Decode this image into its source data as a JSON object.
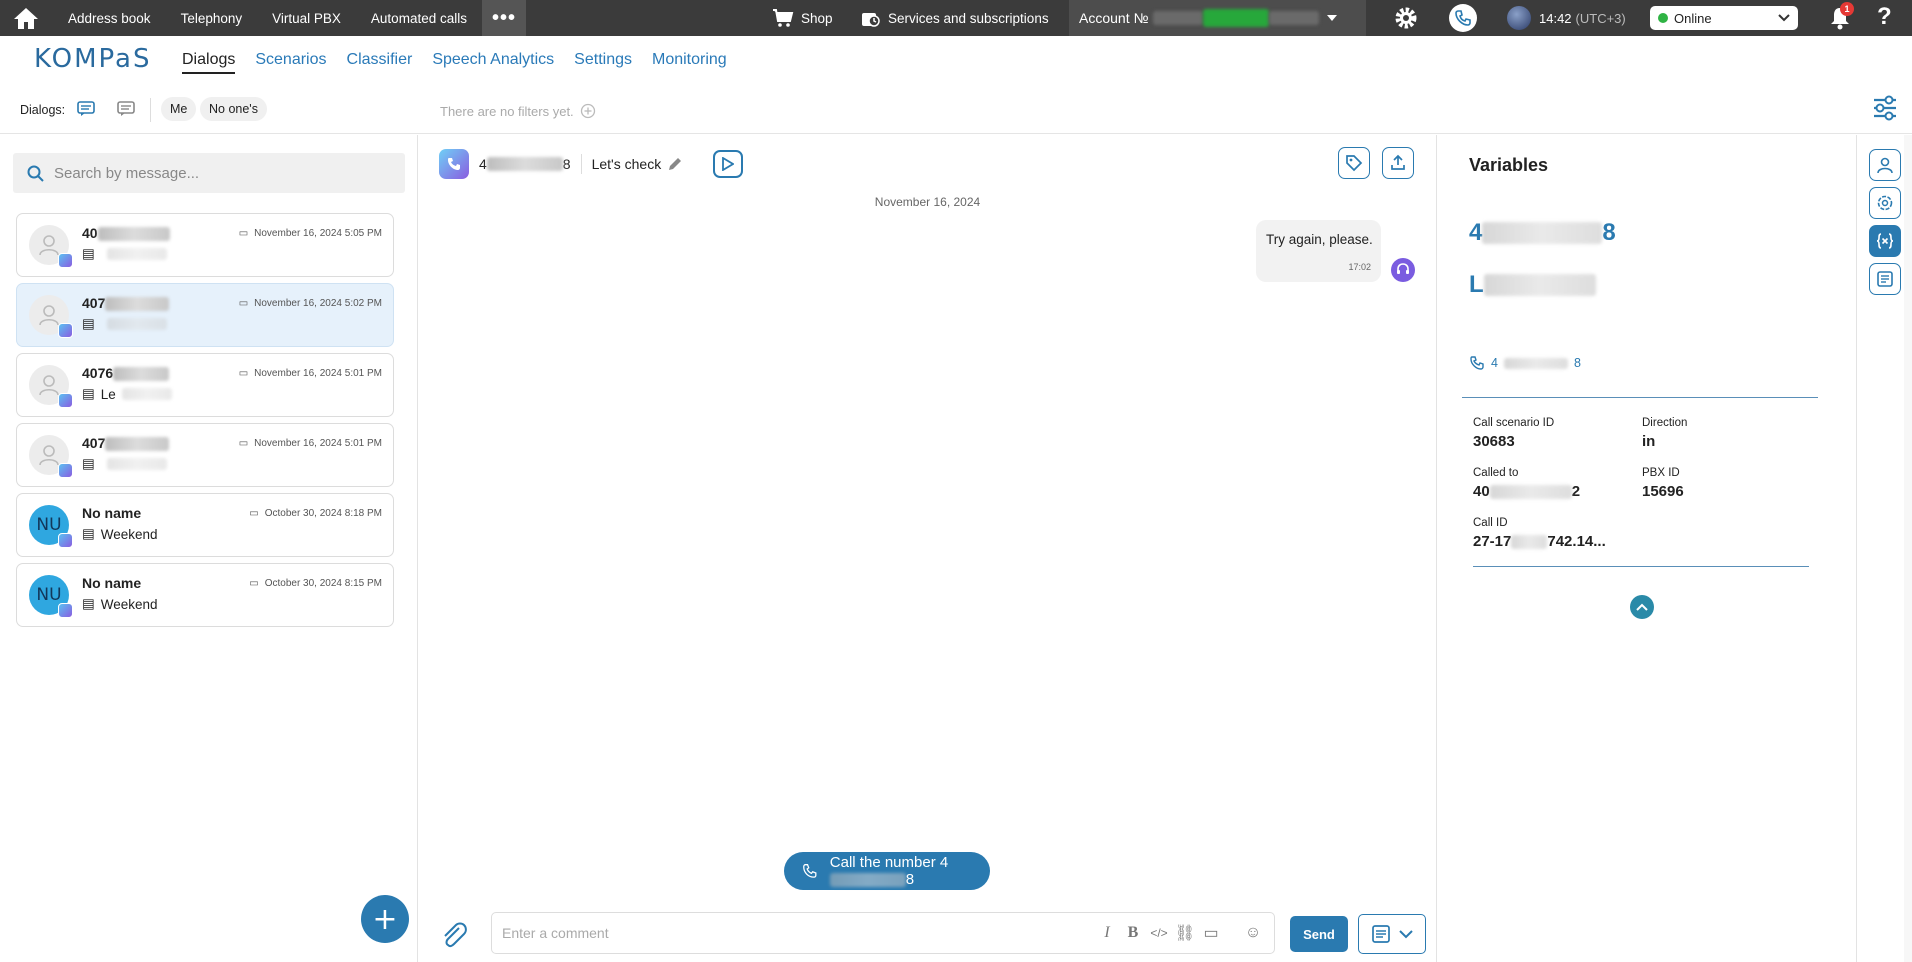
{
  "topbar": {
    "links": [
      "Address book",
      "Telephony",
      "Virtual PBX",
      "Automated calls"
    ],
    "shop": "Shop",
    "services": "Services and subscriptions",
    "account_label": "Account №",
    "time": "14:42",
    "timezone": "(UTC+3)",
    "status": "Online",
    "notifications": "1",
    "help": "?"
  },
  "nav": {
    "logo": "KOMPaS",
    "tabs": [
      "Dialogs",
      "Scenarios",
      "Classifier",
      "Speech Analytics",
      "Settings",
      "Monitoring"
    ],
    "active_tab": "Dialogs"
  },
  "filters": {
    "label": "Dialogs:",
    "chip_me": "Me",
    "chip_noones": "No one's",
    "empty": "There are no filters yet."
  },
  "search": {
    "placeholder": "Search by message..."
  },
  "dialogs": [
    {
      "name": "40",
      "preview": "",
      "date": "November 16, 2024 5:05 PM",
      "avatar": ""
    },
    {
      "name": "407",
      "preview": "",
      "date": "November 16, 2024 5:02 PM",
      "avatar": ""
    },
    {
      "name": "4076",
      "preview": "Le",
      "date": "November 16, 2024 5:01 PM",
      "avatar": ""
    },
    {
      "name": "407",
      "preview": "",
      "date": "November 16, 2024 5:01 PM",
      "avatar": ""
    },
    {
      "name": "No name",
      "preview": "Weekend",
      "date": "October 30, 2024 8:18 PM",
      "avatar": "NU"
    },
    {
      "name": "No name",
      "preview": "Weekend",
      "date": "October 30, 2024 8:15 PM",
      "avatar": "NU"
    }
  ],
  "chat": {
    "number_start": "4",
    "number_end": "8",
    "title": "Let's check",
    "day": "November 16, 2024",
    "message": "Try again, please.",
    "message_time": "17:02",
    "call_label": "Call the number",
    "call_number_start": "4",
    "call_number_end": "8",
    "comment_placeholder": "Enter a comment",
    "send": "Send"
  },
  "variables": {
    "title": "Variables",
    "big_number_start": "4",
    "big_number_end": "8",
    "big_name_start": "L",
    "phone_start": "4",
    "phone_end": "8",
    "scenario_id_label": "Call scenario ID",
    "scenario_id": "30683",
    "direction_label": "Direction",
    "direction": "in",
    "called_to_label": "Called to",
    "called_to_start": "40",
    "called_to_end": "2",
    "pbx_id_label": "PBX ID",
    "pbx_id": "15696",
    "call_id_label": "Call ID",
    "call_id_start": "27-17",
    "call_id_end": "742.14..."
  },
  "colors": {
    "accent": "#2a7ab0",
    "topbar": "#3b3b3b",
    "online": "#2fb344",
    "selected_row": "#e6f1fb"
  }
}
